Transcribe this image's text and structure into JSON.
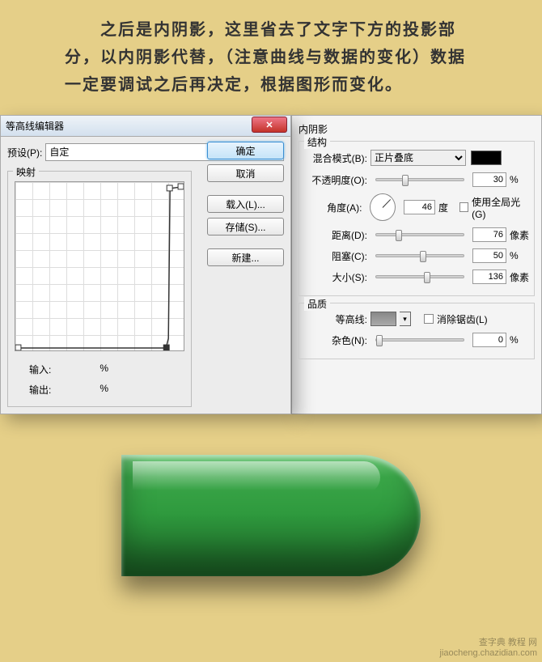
{
  "intro": "　　之后是内阴影，这里省去了文字下方的投影部分，以内阴影代替，（注意曲线与数据的变化）数据一定要调试之后再决定，根据图形而变化。",
  "contourEditor": {
    "title": "等高线编辑器",
    "presetLabel": "预设(P):",
    "presetValue": "自定",
    "ok": "确定",
    "cancel": "取消",
    "load": "载入(L)...",
    "save": "存储(S)...",
    "new": "新建...",
    "mapLegend": "映射",
    "inputLabel": "输入:",
    "outputLabel": "输出:",
    "percent": "%"
  },
  "innerShadow": {
    "title": "内阴影",
    "structure": "结构",
    "blendLabel": "混合模式(B):",
    "blendValue": "正片叠底",
    "opacityLabel": "不透明度(O):",
    "opacityValue": "30",
    "angleLabel": "角度(A):",
    "angleValue": "46",
    "degree": "度",
    "useGlobal": "使用全局光(G)",
    "distanceLabel": "距离(D):",
    "distanceValue": "76",
    "px": "像素",
    "chokeLabel": "阻塞(C):",
    "chokeValue": "50",
    "sizeLabel": "大小(S):",
    "sizeValue": "136",
    "quality": "品质",
    "contourLabel": "等高线:",
    "antialias": "消除锯齿(L)",
    "noiseLabel": "杂色(N):",
    "noiseValue": "0"
  },
  "watermark": {
    "line1": "查字典 教程 网",
    "line2": "jiaocheng.chazidian.com"
  }
}
